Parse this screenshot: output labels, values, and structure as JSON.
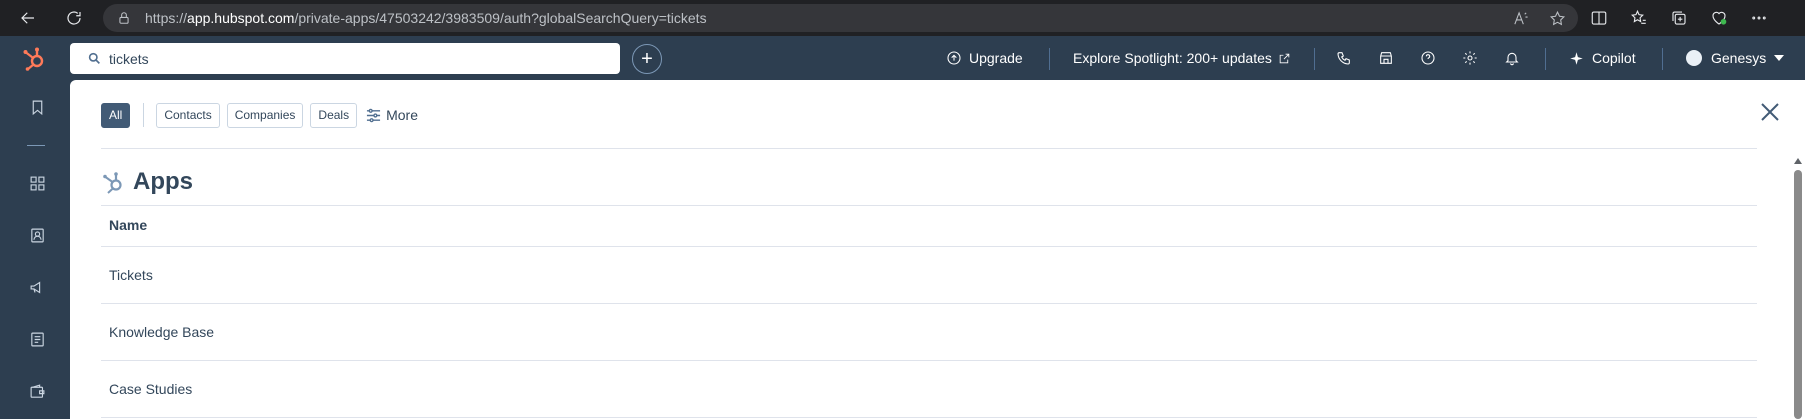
{
  "browser": {
    "url_prefix": "https://",
    "url_host": "app.hubspot.com",
    "url_path": "/private-apps/47503242/3983509/auth?globalSearchQuery=tickets"
  },
  "topnav": {
    "search_value": "tickets",
    "upgrade_label": "Upgrade",
    "spotlight_label": "Explore Spotlight: 200+ updates",
    "copilot_label": "Copilot",
    "account_label": "Genesys"
  },
  "filters": {
    "all": "All",
    "contacts": "Contacts",
    "companies": "Companies",
    "deals": "Deals",
    "more": "More"
  },
  "results": {
    "section_title": "Apps",
    "column_header": "Name",
    "rows": [
      "Tickets",
      "Knowledge Base",
      "Case Studies"
    ]
  },
  "colors": {
    "nav_bg": "#2d3e50",
    "accent": "#ff7a59",
    "active_chip": "#425b76"
  }
}
